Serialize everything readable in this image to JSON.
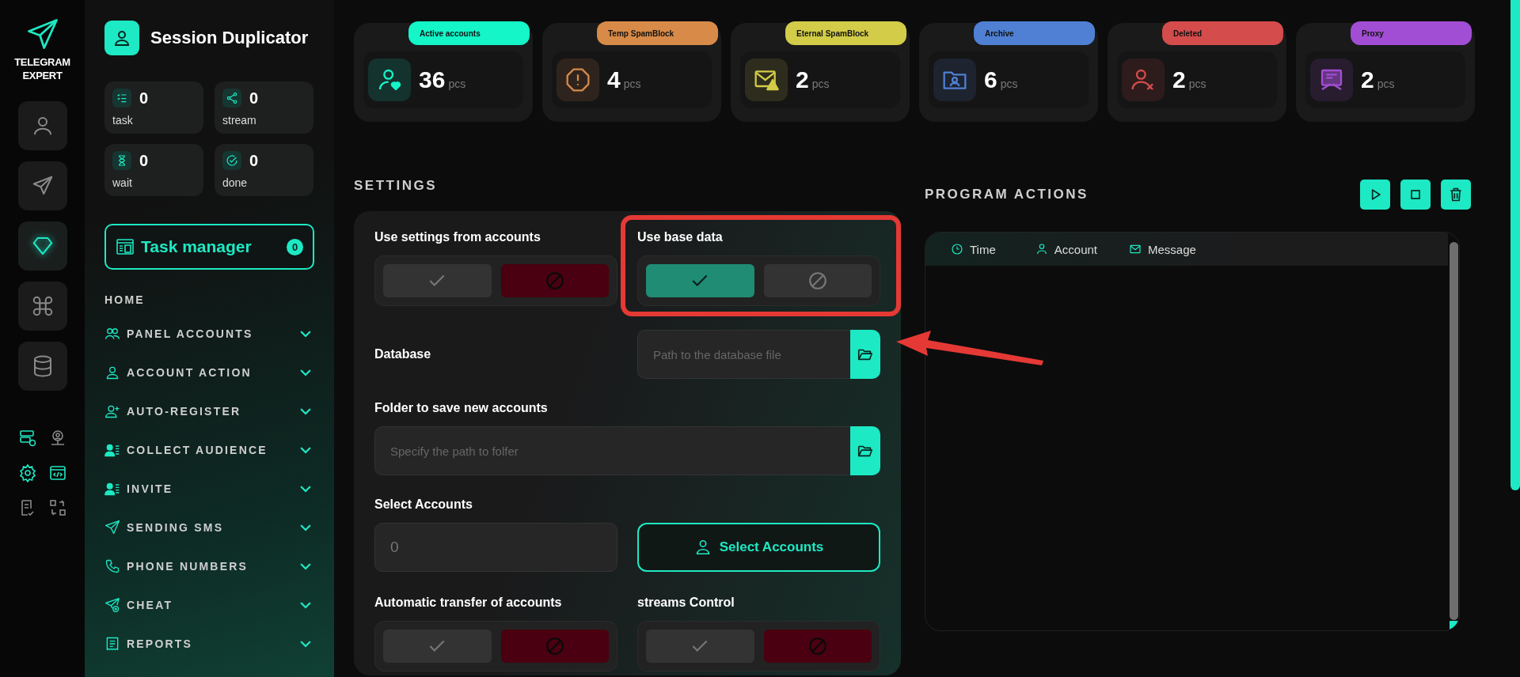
{
  "brand": {
    "name": "TELEGRAM EXPERT"
  },
  "rail": [
    {
      "selected": false
    },
    {
      "selected": false
    },
    {
      "selected": true
    },
    {
      "selected": false
    },
    {
      "selected": false
    }
  ],
  "tools": [
    {
      "highlighted": true
    },
    {
      "highlighted": false
    },
    {
      "highlighted": true
    },
    {
      "highlighted": true
    },
    {
      "highlighted": false
    },
    {
      "highlighted": false
    }
  ],
  "app": {
    "title": "Session Duplicator"
  },
  "counters": [
    {
      "value": "0",
      "label": "task"
    },
    {
      "value": "0",
      "label": "stream"
    },
    {
      "value": "0",
      "label": "wait"
    },
    {
      "value": "0",
      "label": "done"
    }
  ],
  "task_manager": {
    "label": "Task manager",
    "count": "0"
  },
  "nav": {
    "heading": "HOME",
    "items": [
      {
        "label": "PANEL ACCOUNTS",
        "expanded": false
      },
      {
        "label": "ACCOUNT ACTION",
        "expanded": false
      },
      {
        "label": "AUTO-REGISTER",
        "expanded": false
      },
      {
        "label": "COLLECT AUDIENCE",
        "expanded": false
      },
      {
        "label": "INVITE",
        "expanded": false
      },
      {
        "label": "SENDING SMS",
        "expanded": false
      },
      {
        "label": "PHONE NUMBERS",
        "expanded": false
      },
      {
        "label": "CHEAT",
        "expanded": false
      },
      {
        "label": "REPORTS",
        "expanded": false
      }
    ]
  },
  "stats": [
    {
      "label": "Active accounts",
      "value": "36",
      "unit": "pcs",
      "color": "#14f5c8"
    },
    {
      "label": "Temp SpamBlock",
      "value": "4",
      "unit": "pcs",
      "color": "#d88a48"
    },
    {
      "label": "Eternal SpamBlock",
      "value": "2",
      "unit": "pcs",
      "color": "#d2cc48"
    },
    {
      "label": "Archive",
      "value": "6",
      "unit": "pcs",
      "color": "#4f80d4"
    },
    {
      "label": "Deleted",
      "value": "2",
      "unit": "pcs",
      "color": "#d44c4c"
    },
    {
      "label": "Proxy",
      "value": "2",
      "unit": "pcs",
      "color": "#a24ed4"
    }
  ],
  "settings": {
    "title": "SETTINGS",
    "use_settings_from_accounts": {
      "label": "Use settings from accounts",
      "on": false
    },
    "use_base_data": {
      "label": "Use base data",
      "on": true
    },
    "database": {
      "label": "Database",
      "placeholder": "Path to the database file"
    },
    "folder": {
      "label": "Folder to save new accounts",
      "placeholder": "Specify the path to folfer"
    },
    "select_accounts": {
      "label": "Select Accounts",
      "placeholder": "0",
      "button": "Select Accounts"
    },
    "automatic_transfer": {
      "label": "Automatic transfer of accounts",
      "on": false
    },
    "streams_control": {
      "label": "streams Control",
      "on": false
    }
  },
  "actions": {
    "title": "PROGRAM ACTIONS",
    "columns": [
      "Time",
      "Account",
      "Message"
    ]
  }
}
